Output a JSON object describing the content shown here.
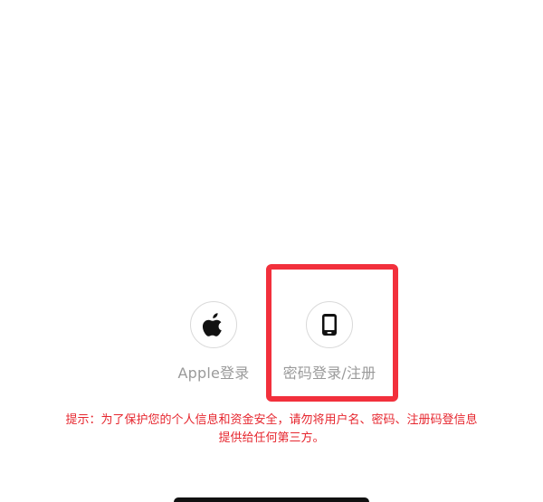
{
  "login_options": {
    "apple": {
      "label": "Apple登录",
      "icon": "apple-logo-icon"
    },
    "password": {
      "label": "密码登录/注册",
      "icon": "phone-icon"
    }
  },
  "notice": {
    "line1": "提示：为了保护您的个人信息和资金安全，请勿将用户名、密码、注册码登信息",
    "line2": "提供给任何第三方。"
  },
  "colors": {
    "highlight": "#f2303c",
    "notice_text": "#e6262e",
    "label_text": "#9a9a9a"
  }
}
